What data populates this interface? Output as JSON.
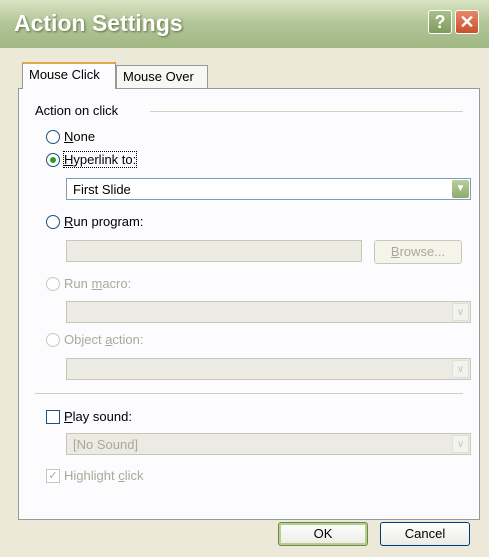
{
  "window": {
    "title": "Action Settings",
    "help_glyph": "?",
    "close_glyph": "✕"
  },
  "tabs": [
    {
      "label": "Mouse Click"
    },
    {
      "label": "Mouse Over"
    }
  ],
  "group": {
    "label": "Action on click"
  },
  "options": {
    "none": {
      "label": "None",
      "key": "N",
      "rest": "one"
    },
    "hyperlink": {
      "label": "Hyperlink to:",
      "key": "H",
      "rest": "yperlink to:",
      "value": "First Slide"
    },
    "run_program": {
      "label": "Run program:",
      "key": "R",
      "rest": "un program:",
      "browse_pre": "",
      "browse_key": "B",
      "browse_rest": "rowse..."
    },
    "run_macro": {
      "pre": "Run ",
      "key": "m",
      "rest": "acro:"
    },
    "object_action": {
      "pre": "Object ",
      "key": "a",
      "rest": "ction:"
    }
  },
  "play_sound": {
    "key": "P",
    "rest": "lay sound:",
    "value": "[No Sound]"
  },
  "highlight": {
    "pre": "Highlight ",
    "key": "c",
    "rest": "lick",
    "checked_glyph": "✓"
  },
  "buttons": {
    "ok": "OK",
    "cancel": "Cancel"
  },
  "colors": {
    "title_bar": "#a9c08e",
    "accent_green": "#21a121",
    "close_red": "#c9502c"
  }
}
